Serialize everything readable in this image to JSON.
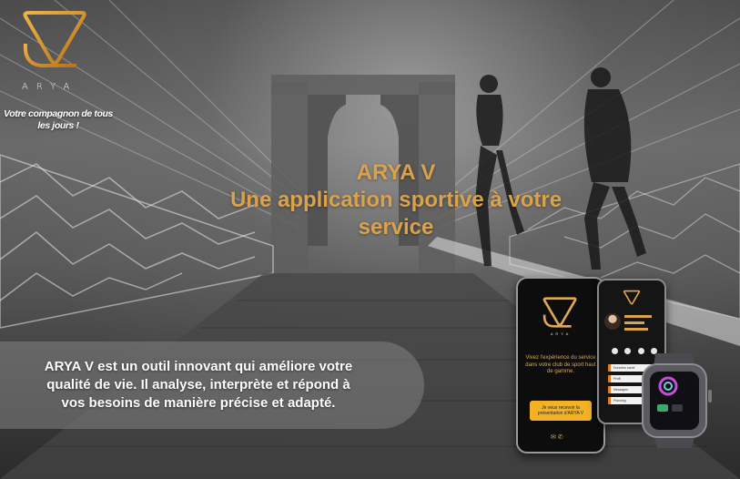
{
  "brand": {
    "logo_icon": "arya-triangle-logo",
    "wordmark": "ARYA",
    "tagline_line1": "Votre compagnon de tous",
    "tagline_line2": "les jours !",
    "accent_color": "#d9a24b"
  },
  "hero": {
    "headline_line1": "ARYA V",
    "headline_line2": "Une application sportive à votre",
    "headline_line3": "service"
  },
  "description": {
    "line1": "ARYA V est un outil innovant qui améliore votre",
    "line2": "qualité de vie. Il analyse, interprète et répond à",
    "line3": "vos besoins de manière précise et adapté."
  },
  "devices": {
    "phone_text": "Vivez l'expérience du service dans votre club de sport haut de gamme.",
    "phone_button": "Je veux recevoir la présentation d'ARYA V",
    "phone_icons": "✉ ✆",
    "menu_items": [
      "Données santé",
      "Profil",
      "Messages",
      "Planning"
    ],
    "watch_icon": "smartwatch-icon"
  }
}
